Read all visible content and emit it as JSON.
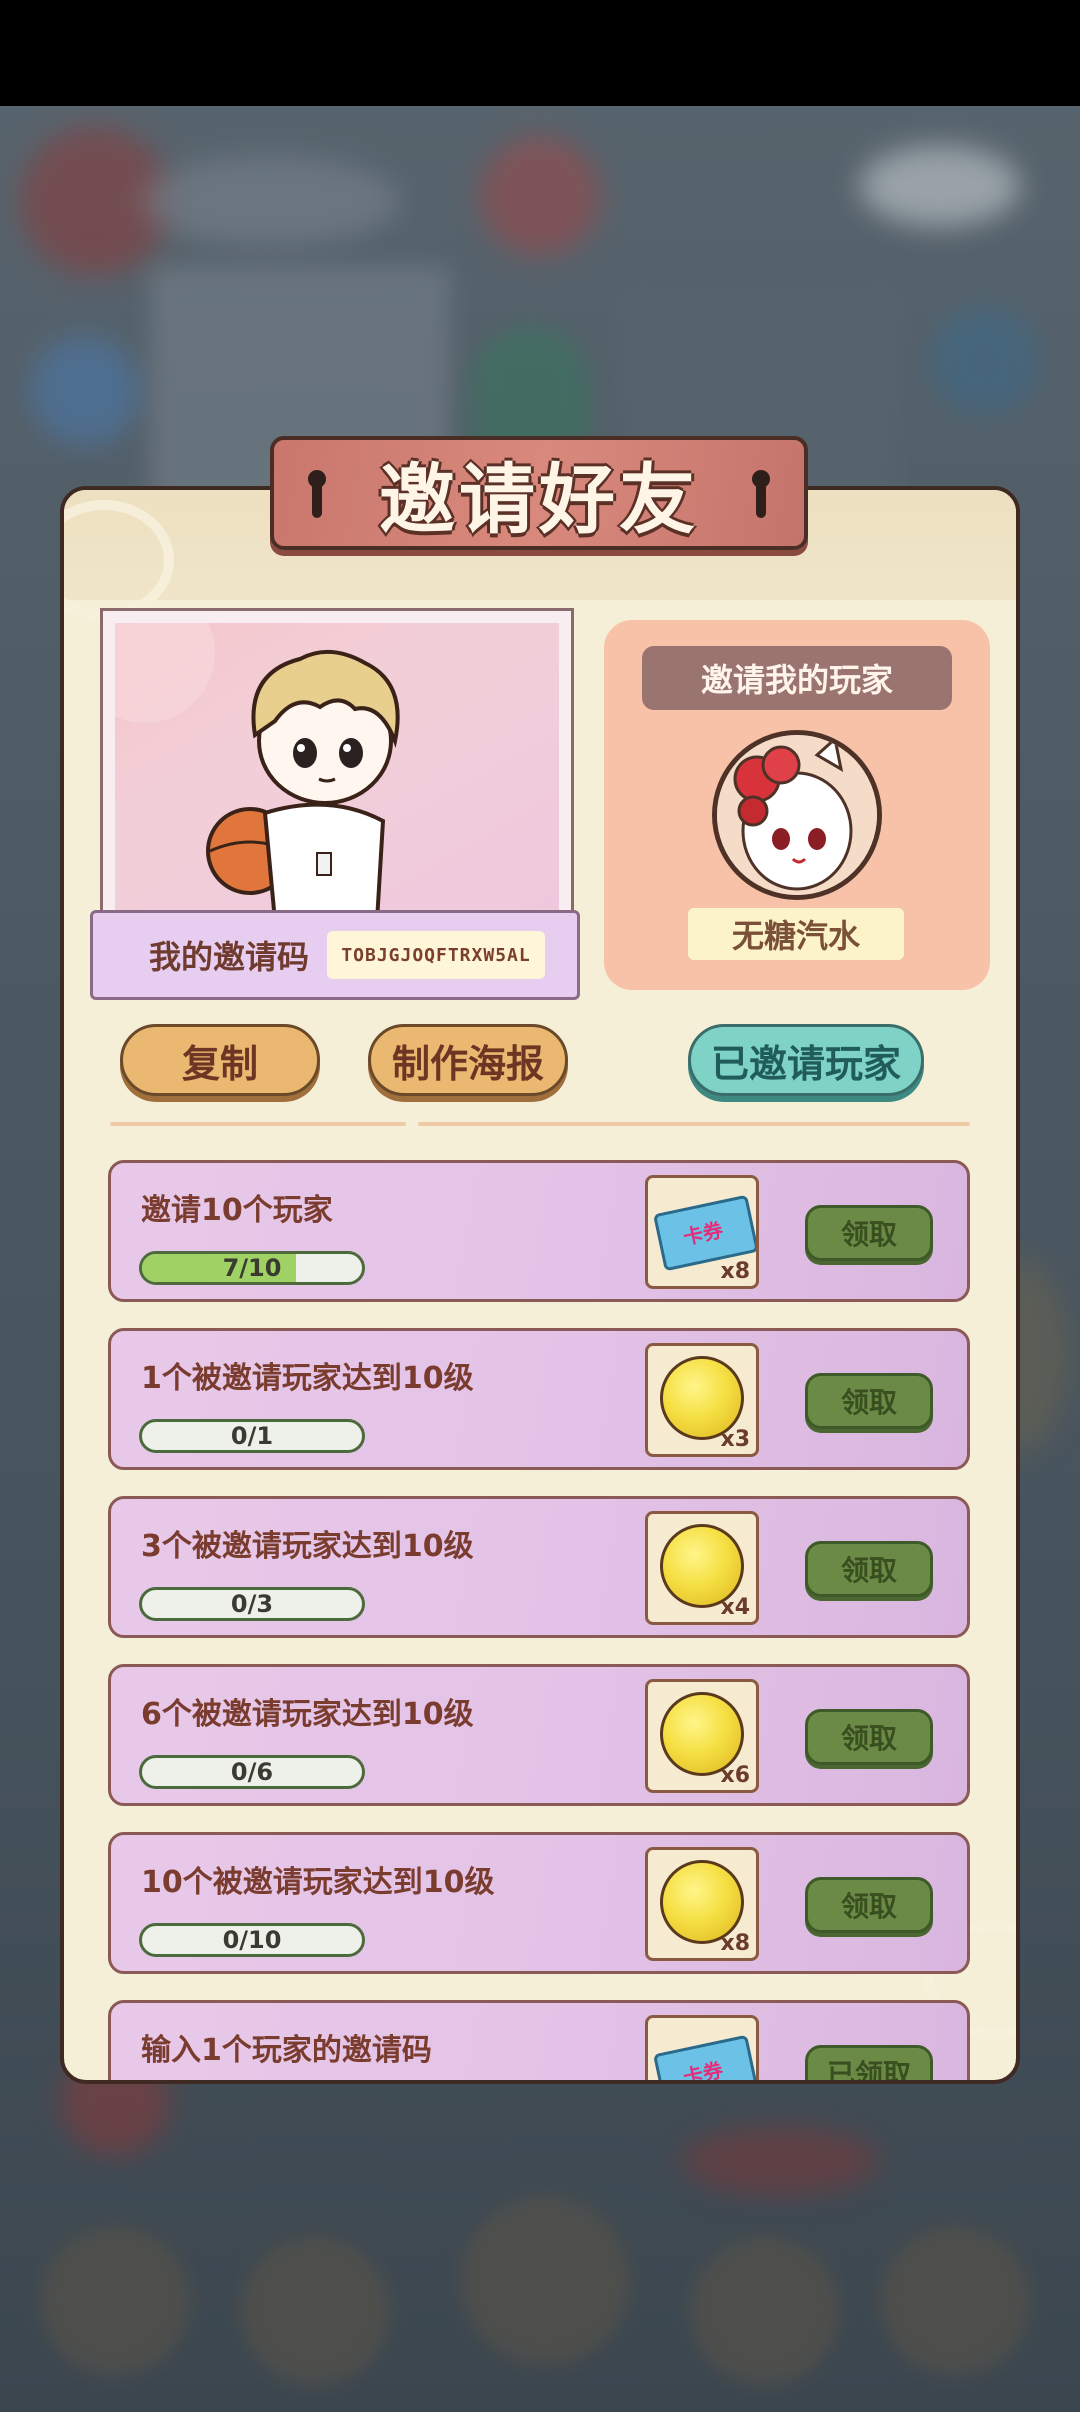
{
  "title": "邀请好友",
  "my_code": {
    "label": "我的邀请码",
    "value": "TOBJGJOQFTRXW5AL"
  },
  "inviter": {
    "title": "邀请我的玩家",
    "name": "无糖汽水"
  },
  "buttons": {
    "copy": "复制",
    "poster": "制作海报",
    "invited": "已邀请玩家"
  },
  "tasks": [
    {
      "title": "邀请10个玩家",
      "progress": "7/10",
      "progress_fraction": 0.7,
      "reward": "ticket",
      "reward_label": "卡券",
      "qty": "x8",
      "button": "领取"
    },
    {
      "title": "1个被邀请玩家达到10级",
      "progress": "0/1",
      "progress_fraction": 0,
      "reward": "coin",
      "qty": "x3",
      "button": "领取"
    },
    {
      "title": "3个被邀请玩家达到10级",
      "progress": "0/3",
      "progress_fraction": 0,
      "reward": "coin",
      "qty": "x4",
      "button": "领取"
    },
    {
      "title": "6个被邀请玩家达到10级",
      "progress": "0/6",
      "progress_fraction": 0,
      "reward": "coin",
      "qty": "x6",
      "button": "领取"
    },
    {
      "title": "10个被邀请玩家达到10级",
      "progress": "0/10",
      "progress_fraction": 0,
      "reward": "coin",
      "qty": "x8",
      "button": "领取"
    },
    {
      "title": "输入1个玩家的邀请码",
      "reward": "ticket",
      "reward_label": "卡券",
      "button": "已领取"
    }
  ]
}
